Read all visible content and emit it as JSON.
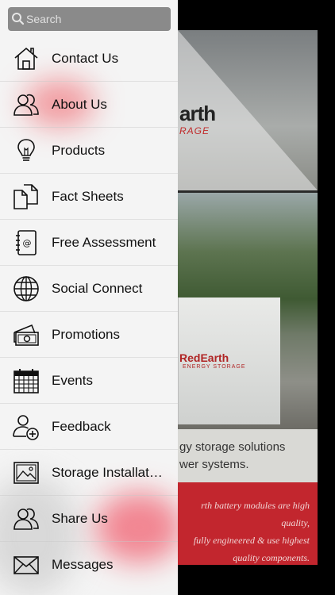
{
  "search": {
    "placeholder": "Search"
  },
  "menu": {
    "items": [
      {
        "label": "Contact Us",
        "icon": "home-icon"
      },
      {
        "label": "About Us",
        "icon": "people-icon"
      },
      {
        "label": "Products",
        "icon": "lightbulb-icon"
      },
      {
        "label": "Fact Sheets",
        "icon": "documents-icon"
      },
      {
        "label": "Free Assessment",
        "icon": "address-book-icon"
      },
      {
        "label": "Social Connect",
        "icon": "globe-icon"
      },
      {
        "label": "Promotions",
        "icon": "money-icon"
      },
      {
        "label": "Events",
        "icon": "calendar-icon"
      },
      {
        "label": "Feedback",
        "icon": "add-user-icon"
      },
      {
        "label": "Storage Installat…",
        "icon": "image-icon"
      },
      {
        "label": "Share Us",
        "icon": "people-icon"
      },
      {
        "label": "Messages",
        "icon": "envelope-icon"
      }
    ]
  },
  "background": {
    "logo_text": "arth",
    "logo_sub": "RAGE",
    "unit_brand": "RedEarth",
    "unit_sub": "ENERGY STORAGE",
    "tagline_lines": [
      "gy storage solutions",
      "wer systems."
    ],
    "red_lines": [
      "rth battery modules are high quality,",
      "fully engineered & use highest",
      "quality components."
    ],
    "colors": {
      "drawer_bg": "#f4f4f4",
      "search_bg": "#8a8a8a",
      "brand_red": "#c2262e"
    }
  }
}
